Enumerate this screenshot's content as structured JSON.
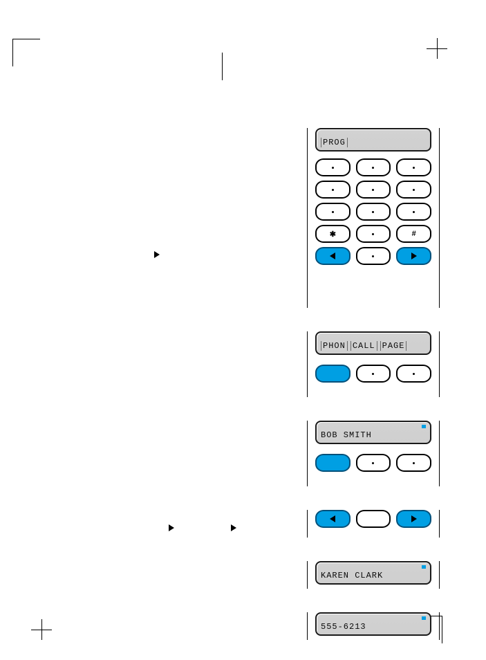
{
  "lcd": {
    "prog": "PROG",
    "menu1": "PHON",
    "menu2": "CALL",
    "menu3": "PAGE",
    "name1": "BOB SMITH",
    "name2": "KAREN CLARK",
    "number": "555-6213"
  },
  "keys": {
    "star": "✱",
    "hash": "#"
  }
}
